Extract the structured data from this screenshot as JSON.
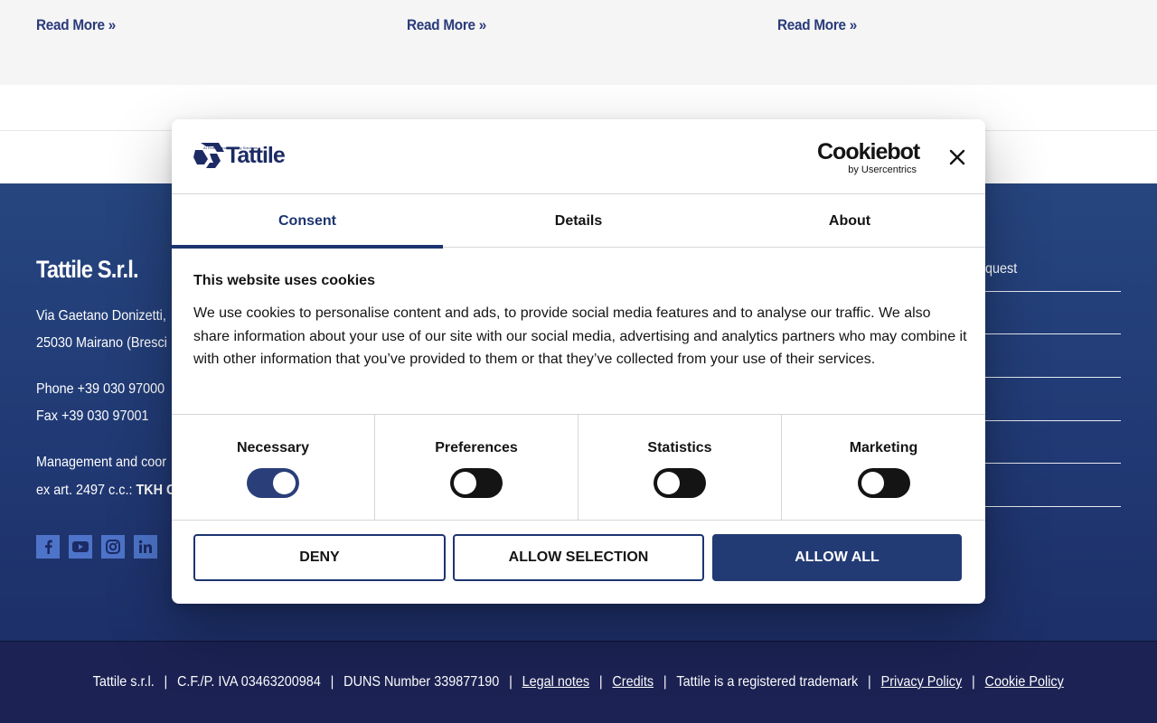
{
  "readmore": [
    "Read More »",
    "Read More »",
    "Read More »"
  ],
  "footer": {
    "company": "Tattile S.r.l.",
    "address_line1": "Via Gaetano Donizetti,",
    "address_line2": "25030 Mairano (Bresci",
    "phone": "Phone +39 030 97000",
    "fax": "Fax +39 030 97001",
    "mgmt_line1": "Management and coor",
    "mgmt_line2_prefix": "ex art. 2497 c.c.:",
    "mgmt_line2_bold": "TKH G",
    "right_link": "quest",
    "social_icons": [
      "facebook-icon",
      "youtube-icon",
      "instagram-icon",
      "linkedin-icon"
    ]
  },
  "bottom": {
    "company": "Tattile s.r.l.",
    "vat": "C.F./P. IVA 03463200984",
    "duns": "DUNS Number 339877190",
    "legal": "Legal notes",
    "credits": "Credits",
    "trademark": "Tattile is a registered trademark",
    "privacy": "Privacy Policy",
    "cookie": "Cookie Policy",
    "sep": "|"
  },
  "dialog": {
    "brand": "Tattile",
    "brand_sub": "AI Performance Mobility Solutions",
    "provider": "Cookiebot",
    "provider_sub": "by Usercentrics",
    "tabs": [
      "Consent",
      "Details",
      "About"
    ],
    "title": "This website uses cookies",
    "text": "We use cookies to personalise content and ads, to provide social media features and to analyse our traffic. We also share information about your use of our site with our social media, advertising and analytics partners who may combine it with other information that you’ve provided to them or that they’ve collected from your use of their services.",
    "categories": [
      {
        "label": "Necessary",
        "on": true
      },
      {
        "label": "Preferences",
        "on": false
      },
      {
        "label": "Statistics",
        "on": false
      },
      {
        "label": "Marketing",
        "on": false
      }
    ],
    "buttons": {
      "deny": "DENY",
      "selection": "ALLOW SELECTION",
      "all": "ALLOW ALL"
    }
  },
  "colors": {
    "brand_blue": "#233b74",
    "footer_blue": "#26457f",
    "bottom_bar": "#1c2354",
    "link_blue": "#2a3a7a",
    "social_blue": "#4d74c9"
  }
}
